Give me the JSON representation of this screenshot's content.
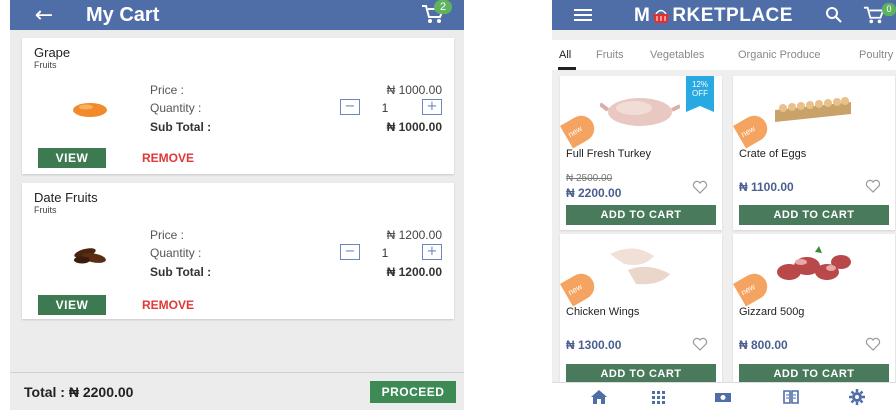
{
  "cart": {
    "title": "My Cart",
    "badge": "2",
    "labels": {
      "price": "Price :",
      "quantity": "Quantity :",
      "subtotal": "Sub Total :",
      "view": "VIEW",
      "remove": "REMOVE"
    },
    "items": [
      {
        "name": "Grape",
        "category": "Fruits",
        "price": "₦ 1000.00",
        "quantity": "1",
        "subtotal": "₦ 1000.00"
      },
      {
        "name": "Date Fruits",
        "category": "Fruits",
        "price": "₦ 1200.00",
        "quantity": "1",
        "subtotal": "₦ 1200.00"
      }
    ],
    "total": "Total : ₦ 2200.00",
    "proceed": "PROCEED"
  },
  "market": {
    "brand_left": "M",
    "brand_right": "RKETPLACE",
    "badge": "0",
    "tabs": [
      "All",
      "Fruits",
      "Vegetables",
      "Organic Produce",
      "Poultry"
    ],
    "products": [
      {
        "name": "Full Fresh Turkey",
        "old_price": "₦ 2500.00",
        "price": "₦ 2200.00",
        "badge": "new",
        "discount": "12% OFF"
      },
      {
        "name": "Crate of Eggs",
        "price": "₦ 1100.00",
        "badge": "new"
      },
      {
        "name": "Chicken Wings",
        "price": "₦ 1300.00",
        "badge": "new"
      },
      {
        "name": "Gizzard 500g",
        "price": "₦ 800.00",
        "badge": "new"
      }
    ],
    "add_to_cart": "ADD TO CART",
    "discount_line1": "12%",
    "discount_line2": "OFF",
    "nav": [
      "home-icon",
      "grid-icon",
      "money-icon",
      "book-icon",
      "gear-icon"
    ]
  },
  "colors": {
    "header": "#4f6ea8",
    "button_green": "#3d7a52",
    "remove_red": "#e03838",
    "badge_green": "#5fb35f",
    "discount_blue": "#29a9e1",
    "new_orange": "#f4a460"
  }
}
